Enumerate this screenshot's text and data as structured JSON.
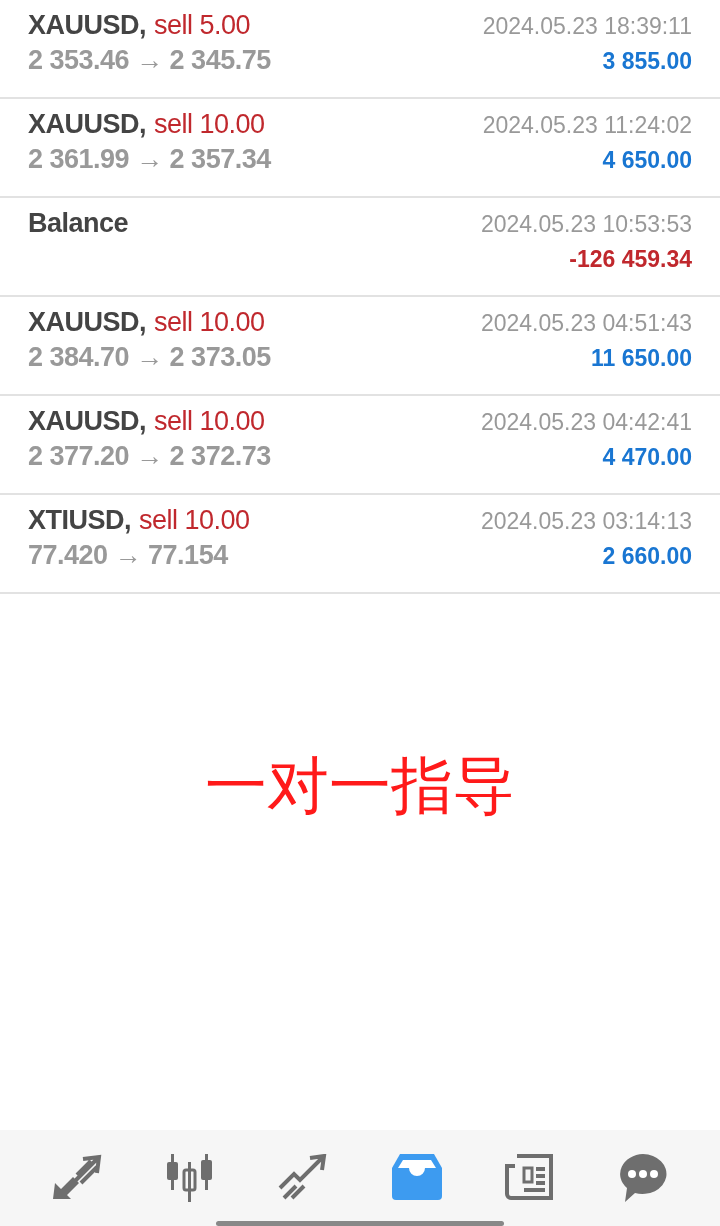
{
  "deals": [
    {
      "kind": "trade",
      "symbol": "XAUUSD,",
      "action": "sell 5.00",
      "prices": "2 353.46 → 2 345.75",
      "time": "2024.05.23 18:39:11",
      "result": "3 855.00",
      "color": "#1976d2"
    },
    {
      "kind": "trade",
      "symbol": "XAUUSD,",
      "action": "sell 10.00",
      "prices": "2 361.99 → 2 357.34",
      "time": "2024.05.23 11:24:02",
      "result": "4 650.00",
      "color": "#1976d2"
    },
    {
      "kind": "balance",
      "symbol": "Balance",
      "time": "2024.05.23 10:53:53",
      "result": "-126 459.34",
      "color": "#c0282d"
    },
    {
      "kind": "trade",
      "symbol": "XAUUSD,",
      "action": "sell 10.00",
      "prices": "2 384.70 → 2 373.05",
      "time": "2024.05.23 04:51:43",
      "result": "11 650.00",
      "color": "#1976d2"
    },
    {
      "kind": "trade",
      "symbol": "XAUUSD,",
      "action": "sell 10.00",
      "prices": "2 377.20 → 2 372.73",
      "time": "2024.05.23 04:42:41",
      "result": "4 470.00",
      "color": "#1976d2"
    },
    {
      "kind": "trade",
      "symbol": "XTIUSD,",
      "action": "sell 10.00",
      "prices": "77.420 → 77.154",
      "time": "2024.05.23 03:14:13",
      "result": "2 660.00",
      "color": "#1976d2"
    }
  ],
  "caption": "一对一指导",
  "nav": [
    {
      "kind": "trade",
      "selected": false
    },
    {
      "kind": "quotes",
      "selected": false
    },
    {
      "kind": "chart",
      "selected": false
    },
    {
      "kind": "history",
      "selected": true
    },
    {
      "kind": "news",
      "selected": false
    },
    {
      "kind": "chat",
      "selected": false
    }
  ]
}
